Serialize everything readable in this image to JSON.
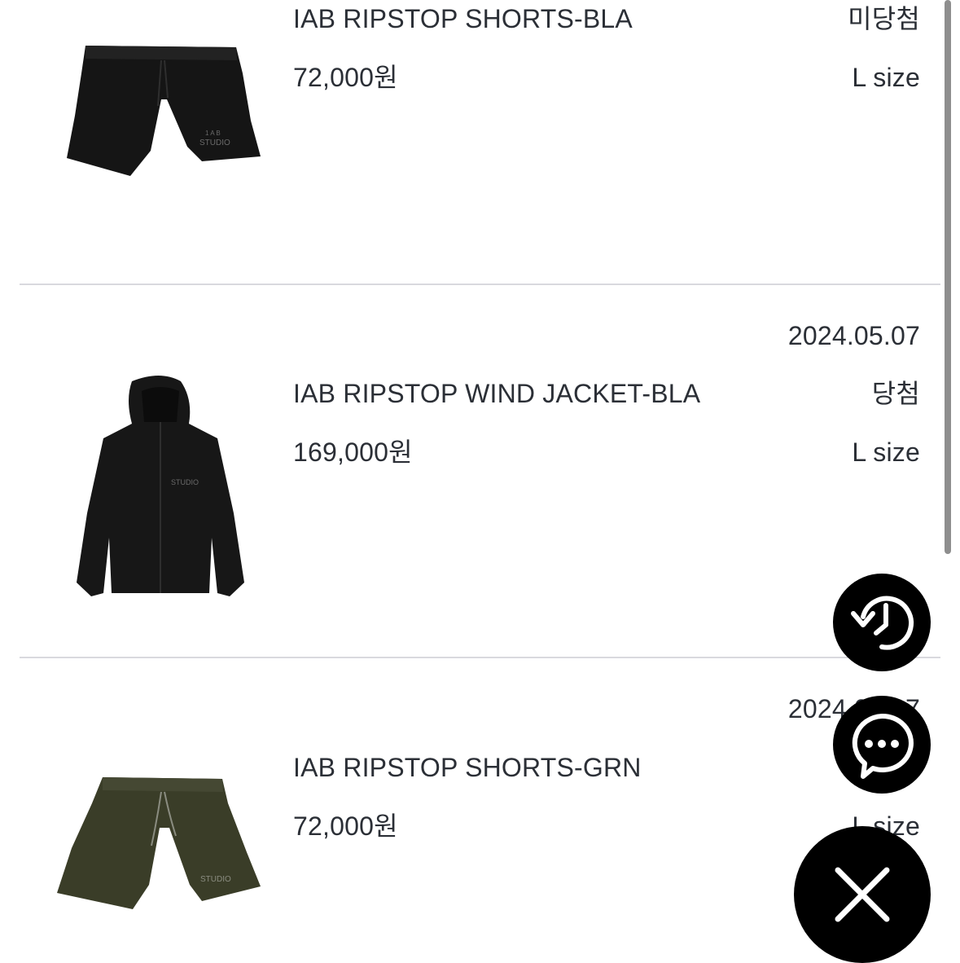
{
  "orders": [
    {
      "date": "",
      "name": "IAB RIPSTOP SHORTS-BLA",
      "price": "72,000원",
      "status": "미당첨",
      "size": "L size",
      "thumb_icon": "black-shorts-image"
    },
    {
      "date": "2024.05.07",
      "name": "IAB RIPSTOP WIND JACKET-BLA",
      "price": "169,000원",
      "status": "당첨",
      "size": "L size",
      "thumb_icon": "black-jacket-image"
    },
    {
      "date": "2024.05.07",
      "name": "IAB RIPSTOP SHORTS-GRN",
      "price": "72,000원",
      "status": "",
      "size": "L size",
      "thumb_icon": "green-shorts-image"
    }
  ],
  "floating_buttons": {
    "history_icon": "history-icon",
    "chat_icon": "chat-icon",
    "close_icon": "close-icon"
  },
  "colors": {
    "text": "#2b2f36",
    "divider": "#d9d9de",
    "fab": "#000000",
    "shorts_black": "#1a1a1a",
    "shorts_green": "#3b3f2a"
  }
}
